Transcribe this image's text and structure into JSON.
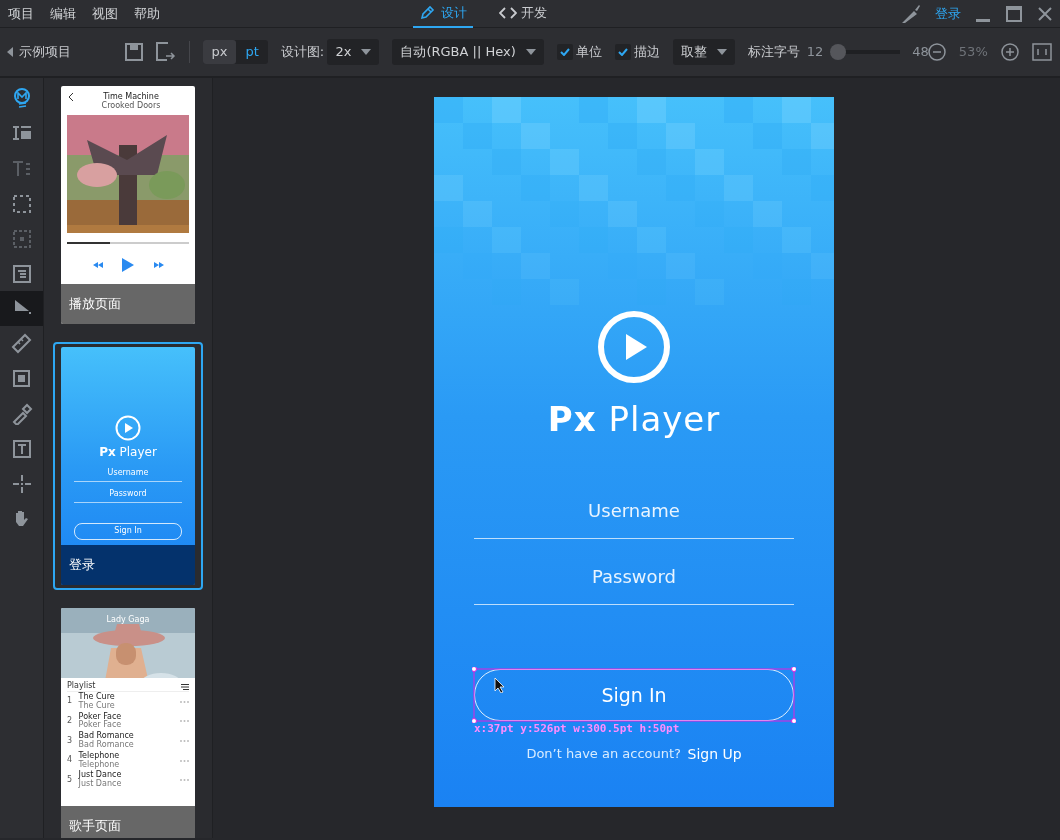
{
  "menu": [
    "项目",
    "编辑",
    "视图",
    "帮助"
  ],
  "modes": [
    {
      "label": "设计",
      "selected": true
    },
    {
      "label": "开发",
      "selected": false
    }
  ],
  "login": "登录",
  "toolbar": {
    "project": "示例项目",
    "units": [
      {
        "label": "px",
        "selected": false
      },
      {
        "label": "pt",
        "selected": true
      }
    ],
    "design_label": "设计图:",
    "design_value": "2x",
    "color_format": "自动(RGBA || Hex)",
    "checks": [
      {
        "label": "单位",
        "checked": true
      },
      {
        "label": "描边",
        "checked": true
      }
    ],
    "rounding": "取整",
    "font_label": "标注字号",
    "font_min": "12",
    "font_max": "48",
    "font_slider": {
      "level": 0
    },
    "zoom": "53%"
  },
  "tools": [
    {
      "selected": false
    },
    {
      "selected": false
    },
    {
      "selected": false
    },
    {
      "selected": false
    },
    {
      "selected": false
    },
    {
      "selected": false
    },
    {
      "selected": true
    },
    {
      "selected": false
    },
    {
      "selected": false
    },
    {
      "selected": false
    },
    {
      "selected": false
    },
    {
      "selected": false
    },
    {
      "selected": false
    }
  ],
  "pages": [
    {
      "kind": "player",
      "label": "播放页面",
      "selected": false,
      "title": "Time Machine",
      "subtitle": "Crooked Doors",
      "level": 0.35
    },
    {
      "kind": "login",
      "label": "登录",
      "selected": true,
      "brand_bold": "Px",
      "brand": "Player",
      "fields": [
        "Username",
        "Password"
      ],
      "button": "Sign In"
    },
    {
      "kind": "artist",
      "label": "歌手页面",
      "selected": false,
      "title": "Lady Gaga",
      "list_title": "Playlist",
      "songs": [
        {
          "no": "1",
          "title": "The Cure",
          "sub": "The Cure"
        },
        {
          "no": "2",
          "title": "Poker Face",
          "sub": "Poker Face"
        },
        {
          "no": "3",
          "title": "Bad Romance",
          "sub": "Bad Romance"
        },
        {
          "no": "4",
          "title": "Telephone",
          "sub": "Telephone"
        },
        {
          "no": "5",
          "title": "Just Dance",
          "sub": "Just Dance"
        }
      ]
    }
  ],
  "design": {
    "brand_bold": "Px",
    "brand": "Player",
    "fields": [
      {
        "placeholder": "Username"
      },
      {
        "placeholder": "Password"
      }
    ],
    "button": "Sign In",
    "measure": "x:37pt y:526pt w:300.5pt h:50pt",
    "prompt": "Don’t have an account?",
    "signup": "Sign Up"
  }
}
